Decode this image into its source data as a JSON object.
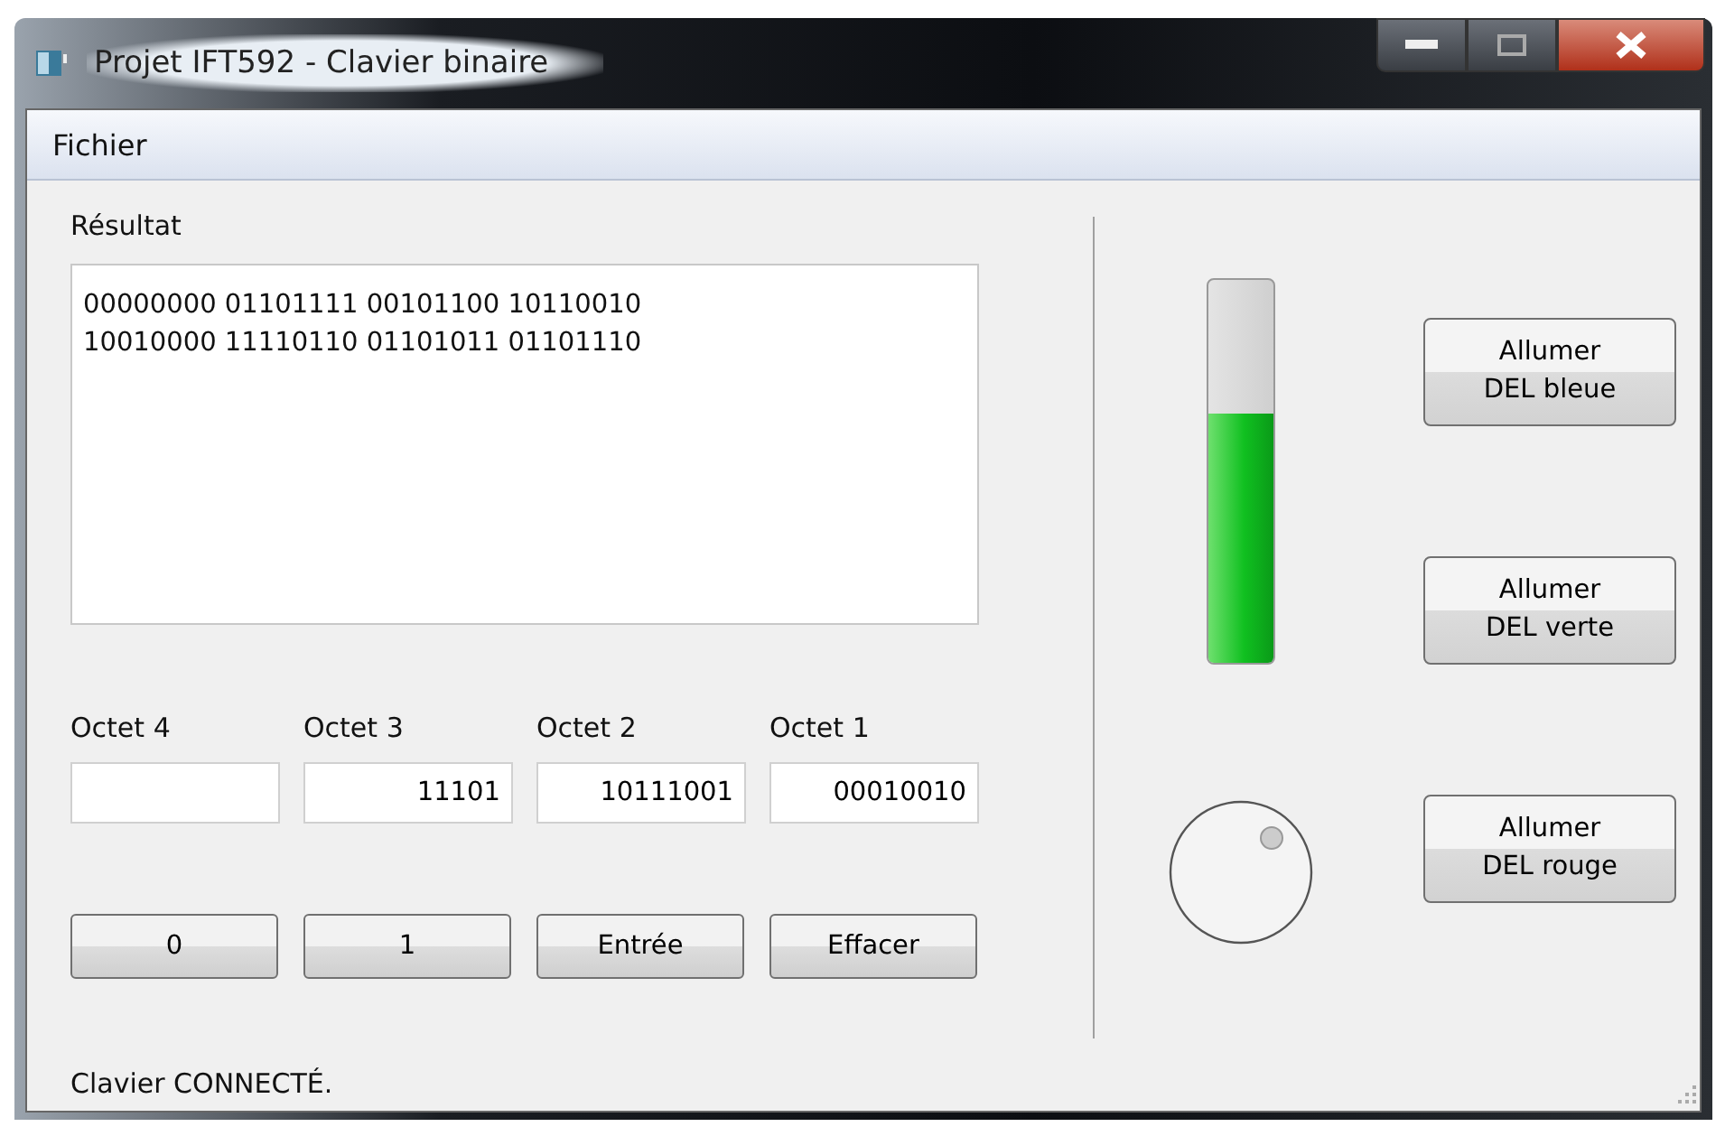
{
  "window": {
    "title": "Projet IFT592 - Clavier binaire"
  },
  "menu": [
    "Fichier"
  ],
  "result": {
    "label": "Résultat",
    "lines": [
      "00000000 01101111 00101100 10110010",
      "10010000 11110110 01101011 01101110"
    ]
  },
  "octets": [
    {
      "label": "Octet 4"
    },
    {
      "label": "Octet 3",
      "value": "11101"
    },
    {
      "label": "Octet 2",
      "value": "10111001"
    },
    {
      "label": "Octet 1",
      "value": "00010010"
    }
  ],
  "buttons": [
    "0",
    "1",
    "Entrée",
    "Effacer"
  ],
  "meter": {
    "level": 0.65
  },
  "led_buttons": [
    {
      "line1": "Allumer",
      "line2": "DEL bleue"
    },
    {
      "line1": "Allumer",
      "line2": "DEL verte"
    },
    {
      "line1": "Allumer",
      "line2": "DEL rouge"
    }
  ],
  "status_bar": "Clavier CONNECTÉ."
}
